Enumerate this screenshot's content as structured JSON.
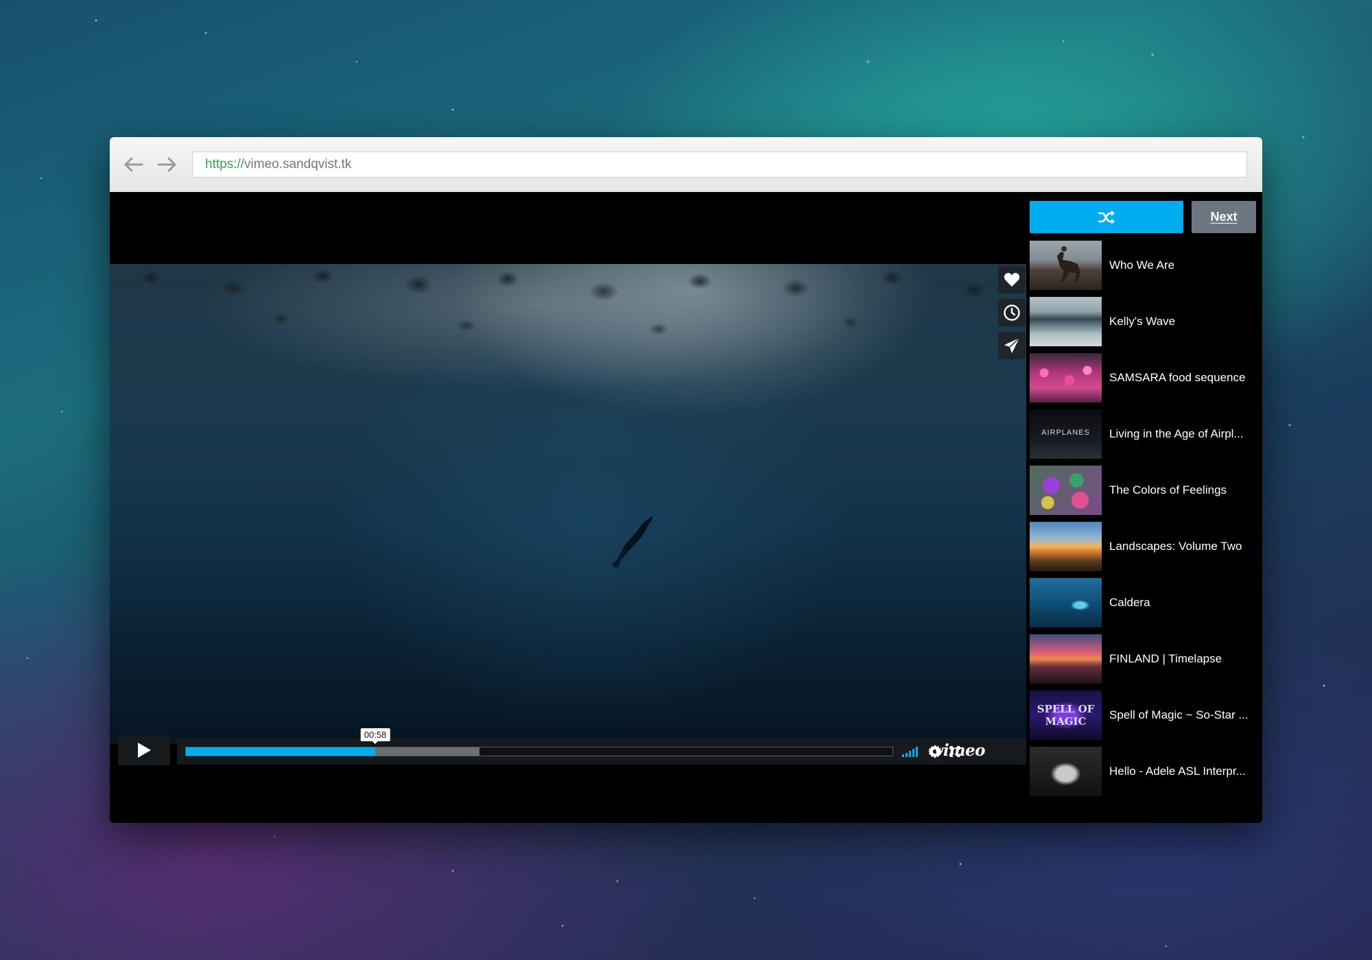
{
  "browser": {
    "url_scheme": "https://",
    "url_rest": "vimeo.sandqvist.tk",
    "back_icon": "arrow-left-icon",
    "forward_icon": "arrow-right-icon"
  },
  "player": {
    "current_time": "00:58",
    "played_fraction": 0.268,
    "buffered_fraction": 0.416,
    "brand": "vimeo",
    "accent_color": "#00adef",
    "side_actions": [
      "heart-icon",
      "clock-icon",
      "paper-plane-icon"
    ],
    "controls": [
      "play-icon",
      "volume-bars-icon",
      "gear-icon",
      "fullscreen-icon"
    ]
  },
  "sidebar": {
    "shuffle_icon": "shuffle-icon",
    "next_label": "Next",
    "playlist": [
      {
        "title": "Who We Are"
      },
      {
        "title": "Kelly's Wave"
      },
      {
        "title": "SAMSARA food sequence"
      },
      {
        "title": "Living in the Age of Airpl...",
        "thumb_text": "AIRPLANES"
      },
      {
        "title": "The Colors of Feelings"
      },
      {
        "title": "Landscapes: Volume Two"
      },
      {
        "title": "Caldera"
      },
      {
        "title": "FINLAND | Timelapse"
      },
      {
        "title": "Spell of Magic ~ So-Star ...",
        "thumb_text": "SPELL OF MAGIC"
      },
      {
        "title": "Hello - Adele ASL Interpr..."
      }
    ]
  }
}
